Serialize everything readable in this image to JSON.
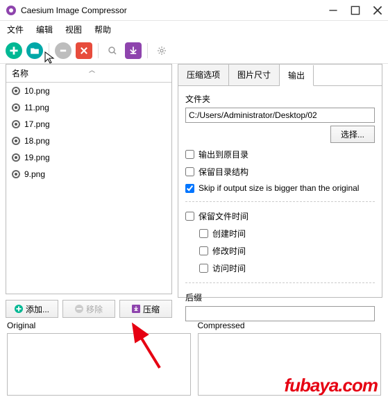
{
  "window": {
    "title": "Caesium Image Compressor"
  },
  "menu": {
    "file": "文件",
    "edit": "编辑",
    "view": "视图",
    "help": "帮助"
  },
  "table": {
    "header": "名称"
  },
  "files": [
    "10.png",
    "11.png",
    "17.png",
    "18.png",
    "19.png",
    "9.png"
  ],
  "buttons": {
    "add": "添加...",
    "remove": "移除",
    "compress": "压缩"
  },
  "tabs": {
    "compress": "压缩选项",
    "size": "图片尺寸",
    "output": "输出"
  },
  "output": {
    "folder_label": "文件夹",
    "folder_value": "C:/Users/Administrator/Desktop/02",
    "select": "选择...",
    "opt_same_folder": "输出到原目录",
    "opt_keep_struct": "保留目录结构",
    "opt_skip_bigger": "Skip if output size is bigger than the original",
    "opt_keep_time": "保留文件时间",
    "opt_ctime": "创建时间",
    "opt_mtime": "修改时间",
    "opt_atime": "访问时间",
    "suffix_label": "后缀",
    "suffix_value": ""
  },
  "preview": {
    "original": "Original",
    "compressed": "Compressed"
  },
  "watermark": "fubaya.com"
}
